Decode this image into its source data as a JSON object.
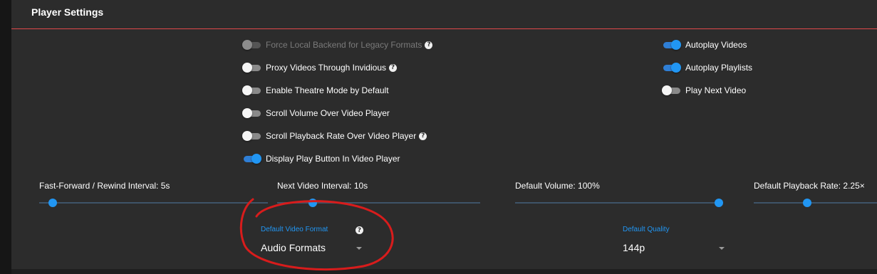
{
  "header": {
    "title": "Player Settings"
  },
  "toggles_left": [
    {
      "label": "Force Local Backend for Legacy Formats",
      "on": false,
      "disabled": true,
      "help": true
    },
    {
      "label": "Proxy Videos Through Invidious",
      "on": false,
      "disabled": false,
      "help": true
    },
    {
      "label": "Enable Theatre Mode by Default",
      "on": false,
      "disabled": false,
      "help": false
    },
    {
      "label": "Scroll Volume Over Video Player",
      "on": false,
      "disabled": false,
      "help": false
    },
    {
      "label": "Scroll Playback Rate Over Video Player",
      "on": false,
      "disabled": false,
      "help": true
    },
    {
      "label": "Display Play Button In Video Player",
      "on": true,
      "disabled": false,
      "help": false
    }
  ],
  "toggles_right": [
    {
      "label": "Autoplay Videos",
      "on": true,
      "disabled": false,
      "help": false
    },
    {
      "label": "Autoplay Playlists",
      "on": true,
      "disabled": false,
      "help": false
    },
    {
      "label": "Play Next Video",
      "on": false,
      "disabled": false,
      "help": false
    }
  ],
  "sliders": [
    {
      "label": "Fast-Forward / Rewind Interval: 5s",
      "fraction": 0.05
    },
    {
      "label": "Next Video Interval: 10s",
      "fraction": 0.18
    },
    {
      "label": "Default Volume: 100%",
      "fraction": 1.0
    },
    {
      "label": "Default Playback Rate: 2.25×",
      "fraction": 0.4
    }
  ],
  "selects": {
    "video_format": {
      "label": "Default Video Format",
      "value": "Audio Formats",
      "help": true
    },
    "quality": {
      "label": "Default Quality",
      "value": "144p"
    }
  },
  "icons": {
    "help": "question-circle-icon",
    "dropdown": "caret-down-icon"
  },
  "colors": {
    "accent": "#2196f3",
    "header_divider": "#e0484a",
    "annotation": "#d81c1c"
  }
}
